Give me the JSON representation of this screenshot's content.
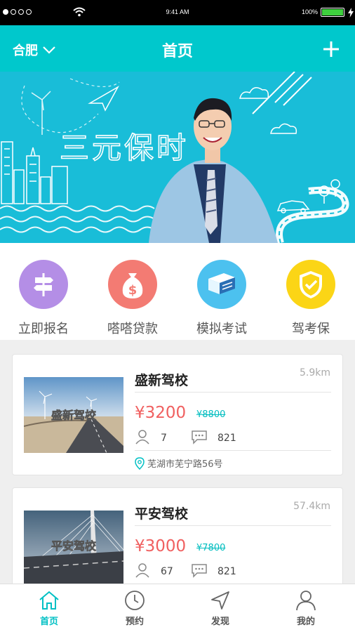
{
  "status_bar": {
    "time": "9:41 AM",
    "battery": "100%"
  },
  "header": {
    "city": "合肥",
    "title": "首页"
  },
  "banner": {
    "headline": "三元保时"
  },
  "quick_menu": [
    {
      "label": "立即报名",
      "icon": "signpost-icon",
      "color": "#b48ee6"
    },
    {
      "label": "嗒嗒贷款",
      "icon": "money-bag-icon",
      "color": "#f37b73"
    },
    {
      "label": "模拟考试",
      "icon": "book-icon",
      "color": "#4cc1ef"
    },
    {
      "label": "驾考保",
      "icon": "shield-check-icon",
      "color": "#fbd516"
    }
  ],
  "schools": [
    {
      "name": "盛新驾校",
      "distance": "5.9km",
      "price": "¥3200",
      "original_price": "¥8800",
      "students": "7",
      "comments": "821",
      "address": "芜湖市芜宁路56号",
      "thumb_text": "盛新驾校"
    },
    {
      "name": "平安驾校",
      "distance": "57.4km",
      "price": "¥3000",
      "original_price": "¥7800",
      "students": "67",
      "comments": "821",
      "thumb_text": "平安驾校"
    }
  ],
  "tabs": [
    {
      "label": "首页",
      "icon": "home-icon",
      "active": true
    },
    {
      "label": "预约",
      "icon": "clock-icon",
      "active": false
    },
    {
      "label": "发现",
      "icon": "navigation-icon",
      "active": false
    },
    {
      "label": "我的",
      "icon": "user-icon",
      "active": false
    }
  ],
  "colors": {
    "accent": "#00c8cc",
    "price": "#f06060"
  }
}
